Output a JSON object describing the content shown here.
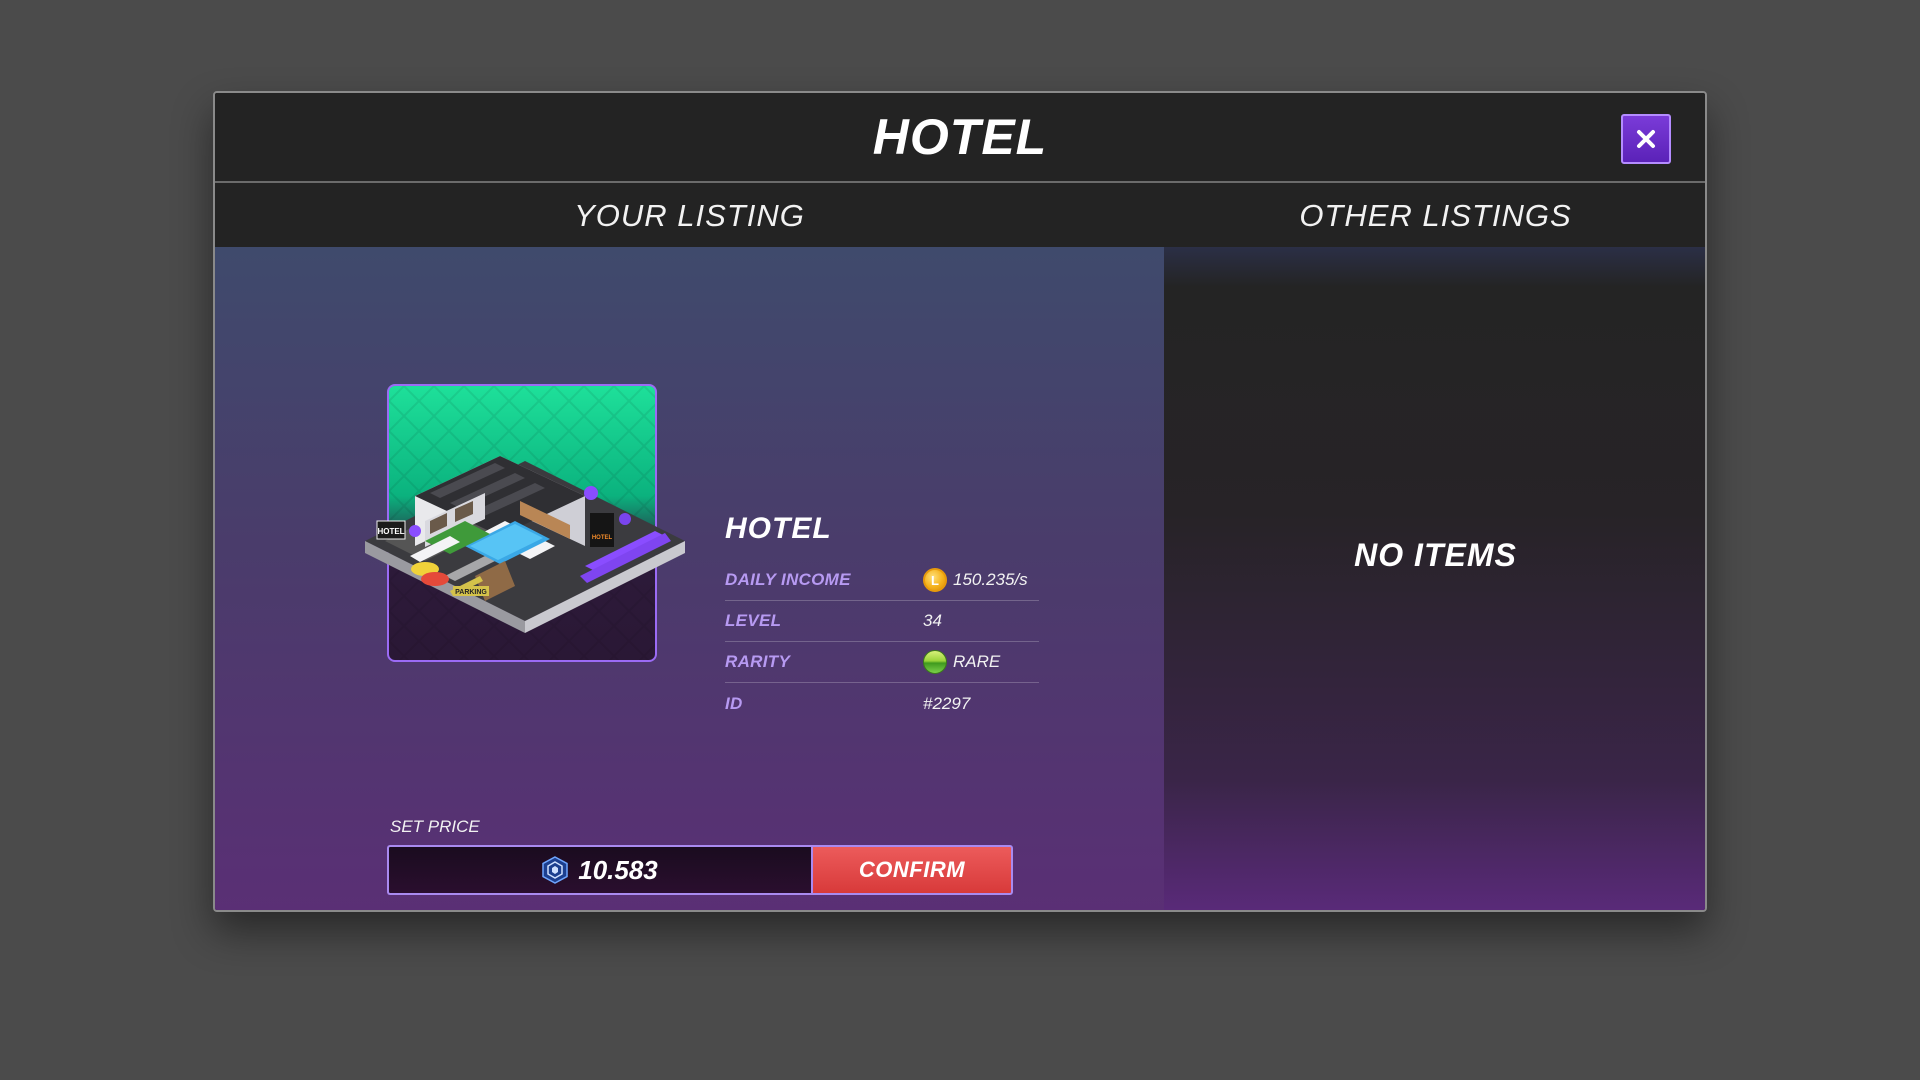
{
  "modal": {
    "title": "HOTEL"
  },
  "tabs": [
    {
      "label": "YOUR LISTING"
    },
    {
      "label": "OTHER LISTINGS"
    }
  ],
  "listing": {
    "item_name": "HOTEL",
    "card_art_signs": [
      "HOTEL",
      "PARKING",
      "HOTEL"
    ],
    "stats": [
      {
        "label": "DAILY INCOME",
        "value": "150.235/s",
        "icon": "coin-icon"
      },
      {
        "label": "LEVEL",
        "value": "34"
      },
      {
        "label": "RARITY",
        "value": "RARE",
        "icon": "rarity-dot-icon"
      },
      {
        "label": "ID",
        "value": "#2297"
      }
    ],
    "coin_glyph": "L",
    "set_price_label": "SET PRICE",
    "price_value": "10.583",
    "price_icon": "cronos-token-icon",
    "confirm_label": "CONFIRM"
  },
  "other_listings": {
    "empty_text": "NO ITEMS"
  },
  "colors": {
    "accent_purple": "#5b22b8",
    "confirm_red": "#d83a3a",
    "label_lavender": "#b79af2",
    "card_green": "#1ee09a"
  }
}
